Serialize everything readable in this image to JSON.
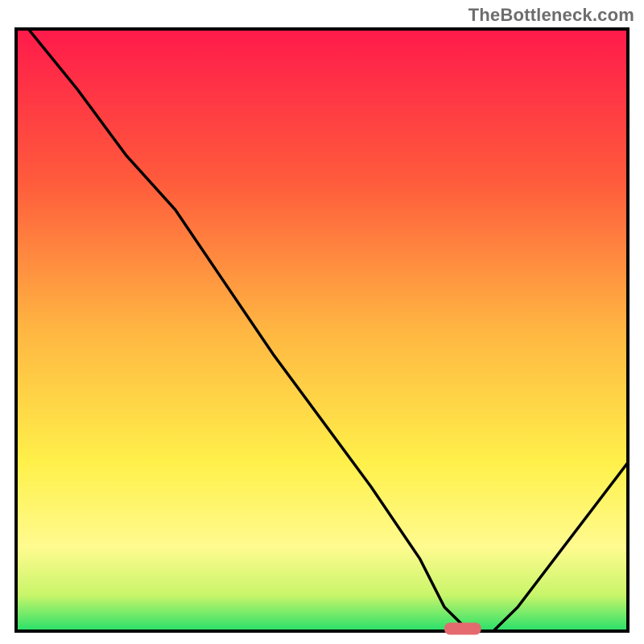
{
  "watermark": "TheBottleneck.com",
  "chart_data": {
    "type": "line",
    "title": "",
    "xlabel": "",
    "ylabel": "",
    "x_range": [
      0,
      100
    ],
    "y_range": [
      0,
      100
    ],
    "notes": "Bottleneck-style curve. Gradient background from red (top) through orange/yellow to green (bottom). Black curve descends from top-left, reaches a flat minimum near x≈73, then rises toward top-right. A short rounded red-pink marker sits at the minimum.",
    "series": [
      {
        "name": "bottleneck-curve",
        "x": [
          2,
          10,
          18,
          26,
          34,
          42,
          50,
          58,
          66,
          70,
          74,
          78,
          82,
          88,
          94,
          100
        ],
        "y": [
          100,
          90,
          79,
          70,
          58,
          46,
          35,
          24,
          12,
          4,
          0,
          0,
          4,
          12,
          20,
          28
        ]
      }
    ],
    "marker": {
      "x": 73,
      "y": 0,
      "width_pct": 6,
      "color": "#e46a6f"
    },
    "gradient_stops": [
      {
        "pct": 0,
        "color": "#ff1a4b"
      },
      {
        "pct": 25,
        "color": "#ff5a3c"
      },
      {
        "pct": 50,
        "color": "#ffb642"
      },
      {
        "pct": 72,
        "color": "#fff04a"
      },
      {
        "pct": 86,
        "color": "#fffb8f"
      },
      {
        "pct": 94,
        "color": "#c9f56a"
      },
      {
        "pct": 100,
        "color": "#26e06a"
      }
    ]
  }
}
